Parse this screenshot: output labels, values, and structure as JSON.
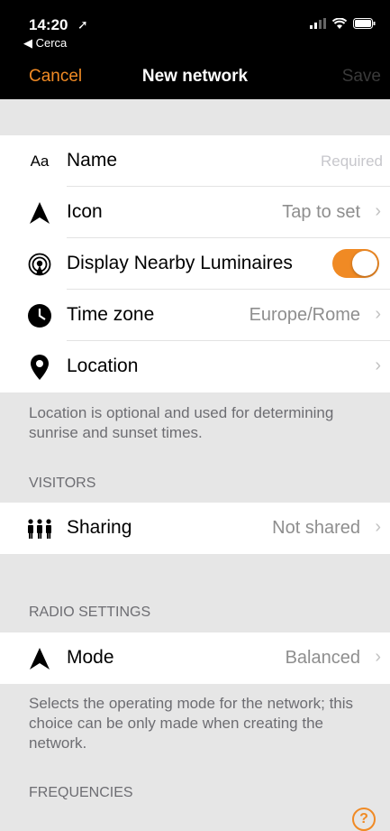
{
  "status": {
    "time": "14:20",
    "back_label": "◀ Cerca"
  },
  "nav": {
    "cancel": "Cancel",
    "title": "New network",
    "save": "Save"
  },
  "rows": {
    "name": {
      "icon": "Aa",
      "label": "Name",
      "placeholder": "Required"
    },
    "icon": {
      "label": "Icon",
      "value": "Tap to set"
    },
    "nearby": {
      "label": "Display Nearby Luminaires",
      "toggle_on": true
    },
    "timezone": {
      "label": "Time zone",
      "value": "Europe/Rome"
    },
    "location": {
      "label": "Location"
    },
    "sharing": {
      "label": "Sharing",
      "value": "Not shared"
    },
    "mode": {
      "label": "Mode",
      "value": "Balanced"
    }
  },
  "chevron": "›",
  "location_footer": "Location is optional and used for determining sunrise and sunset times.",
  "sections": {
    "visitors": "VISITORS",
    "radio": "RADIO SETTINGS",
    "frequencies": "FREQUENCIES"
  },
  "mode_footer": "Selects the operating mode for the network; this choice can be only made when creating the network.",
  "help": "?",
  "colors": {
    "accent": "#f08a24",
    "background": "#e6e6e6",
    "bar": "#000000"
  }
}
